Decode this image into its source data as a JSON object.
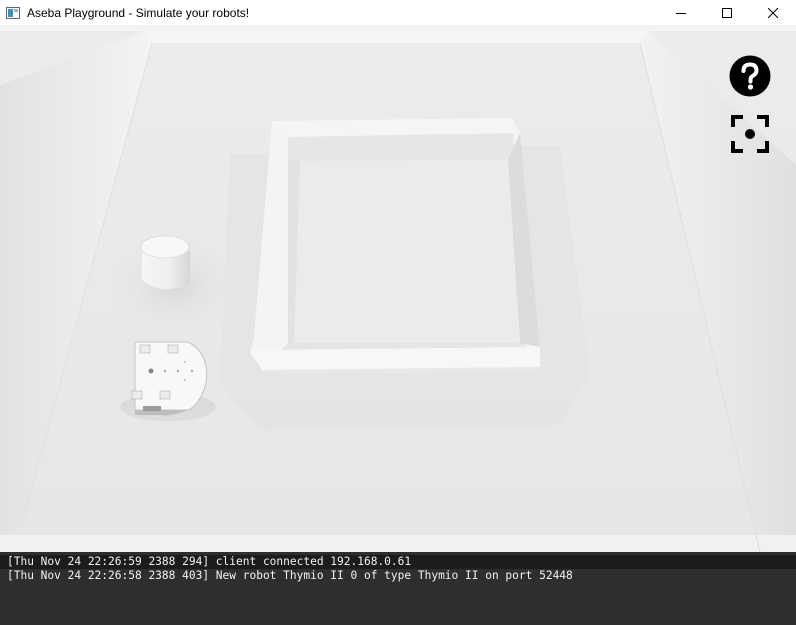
{
  "window": {
    "title": "Aseba Playground - Simulate your robots!",
    "controls": [
      "minimize",
      "maximize",
      "close"
    ]
  },
  "overlay": {
    "help_icon": "question-mark-icon",
    "fullscreen_icon": "fullscreen-focus-icon"
  },
  "scene": {
    "objects": [
      "arena-floor",
      "arena-outer-wall",
      "inner-square-enclosure",
      "cylinder-obstacle",
      "thymio-robot"
    ],
    "robot_label": "Thymio II"
  },
  "console": {
    "lines": [
      "[Thu Nov 24 22:26:59 2388 294] client connected 192.168.0.61",
      "[Thu Nov 24 22:26:58 2388 403] New robot Thymio II 0 of type Thymio II on port 52448"
    ]
  },
  "colors": {
    "console_bg": "#2e2e2e",
    "console_text": "#f2f2f2",
    "arena_floor": "#e9e9e9",
    "icon": "#000000"
  }
}
